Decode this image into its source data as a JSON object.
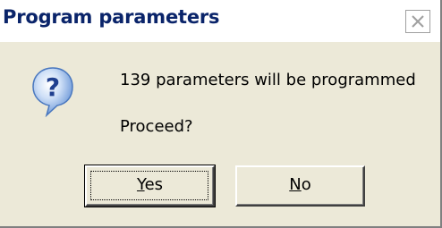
{
  "dialog": {
    "title": "Program parameters",
    "close_icon": "close-icon",
    "message_icon": "question-icon",
    "message": "139 parameters will be programmed",
    "prompt": "Proceed?"
  },
  "buttons": {
    "yes": {
      "mnemonic": "Y",
      "rest": "es",
      "label": "Yes"
    },
    "no": {
      "mnemonic": "N",
      "rest": "o",
      "label": "No"
    }
  },
  "colors": {
    "title_text": "#0a246a",
    "dialog_face": "#ece9d8",
    "icon_blue": "#1f5fbf"
  }
}
